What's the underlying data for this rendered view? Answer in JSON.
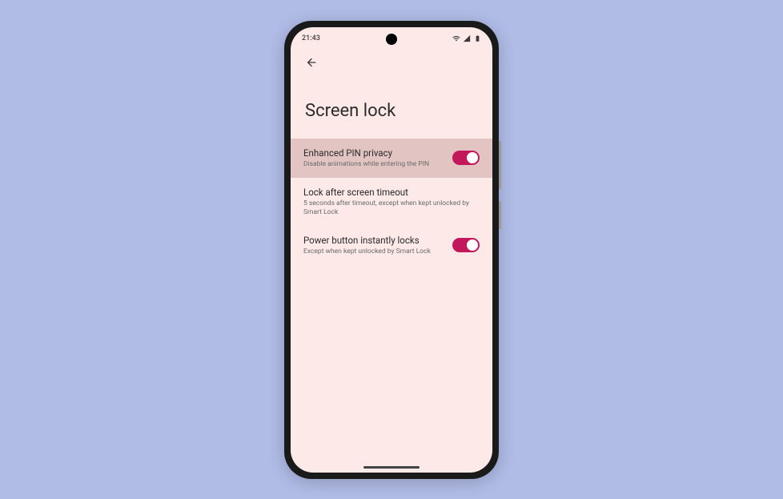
{
  "status": {
    "time": "21:43"
  },
  "page": {
    "title": "Screen lock"
  },
  "settings": [
    {
      "title": "Enhanced PIN privacy",
      "subtitle": "Disable animations while entering the PIN",
      "has_toggle": true
    },
    {
      "title": "Lock after screen timeout",
      "subtitle": "5 seconds after timeout, except when kept unlocked by Smart Lock",
      "has_toggle": false
    },
    {
      "title": "Power button instantly locks",
      "subtitle": "Except when kept unlocked by Smart Lock",
      "has_toggle": true
    }
  ]
}
